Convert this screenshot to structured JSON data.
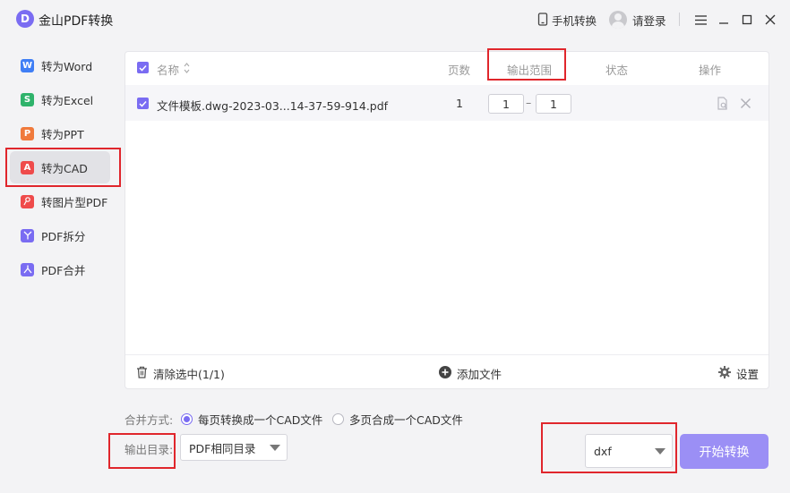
{
  "app": {
    "logo_letter": "D",
    "title": "金山PDF转换"
  },
  "topbar": {
    "mobile_label": "手机转换",
    "login_label": "请登录"
  },
  "sidebar": {
    "items": [
      {
        "label": "转为Word",
        "icon": "W",
        "color": "#3f7ef5"
      },
      {
        "label": "转为Excel",
        "icon": "S",
        "color": "#2fb36b"
      },
      {
        "label": "转为PPT",
        "icon": "P",
        "color": "#f07a3c"
      },
      {
        "label": "转为CAD",
        "icon": "A",
        "color": "#ef4b4b",
        "active": true
      },
      {
        "label": "转图片型PDF",
        "icon": "P",
        "color": "#ef4b4b"
      },
      {
        "label": "PDF拆分",
        "icon": "split",
        "color": "#7a6cf2"
      },
      {
        "label": "PDF合并",
        "icon": "merge",
        "color": "#7a6cf2"
      }
    ]
  },
  "table": {
    "headers": {
      "name": "名称",
      "pages": "页数",
      "range": "输出范围",
      "status": "状态",
      "actions": "操作"
    },
    "rows": [
      {
        "filename": "文件模板.dwg-2023-03...14-37-59-914.pdf",
        "pages": "1",
        "range_from": "1",
        "range_sep": "–",
        "range_to": "1",
        "status": ""
      }
    ]
  },
  "footer": {
    "clear_label": "清除选中(1/1)",
    "add_label": "添加文件",
    "settings_label": "设置"
  },
  "merge": {
    "label": "合并方式:",
    "options": [
      {
        "label": "每页转换成一个CAD文件",
        "selected": true
      },
      {
        "label": "多页合成一个CAD文件",
        "selected": false
      }
    ]
  },
  "output": {
    "dir_label": "输出目录:",
    "dir_value": "PDF相同目录"
  },
  "format": {
    "value": "dxf"
  },
  "start_button": "开始转换",
  "colors": {
    "accent": "#7a6cf2",
    "highlight": "#e0262c",
    "start_button": "#9b8ff5"
  }
}
